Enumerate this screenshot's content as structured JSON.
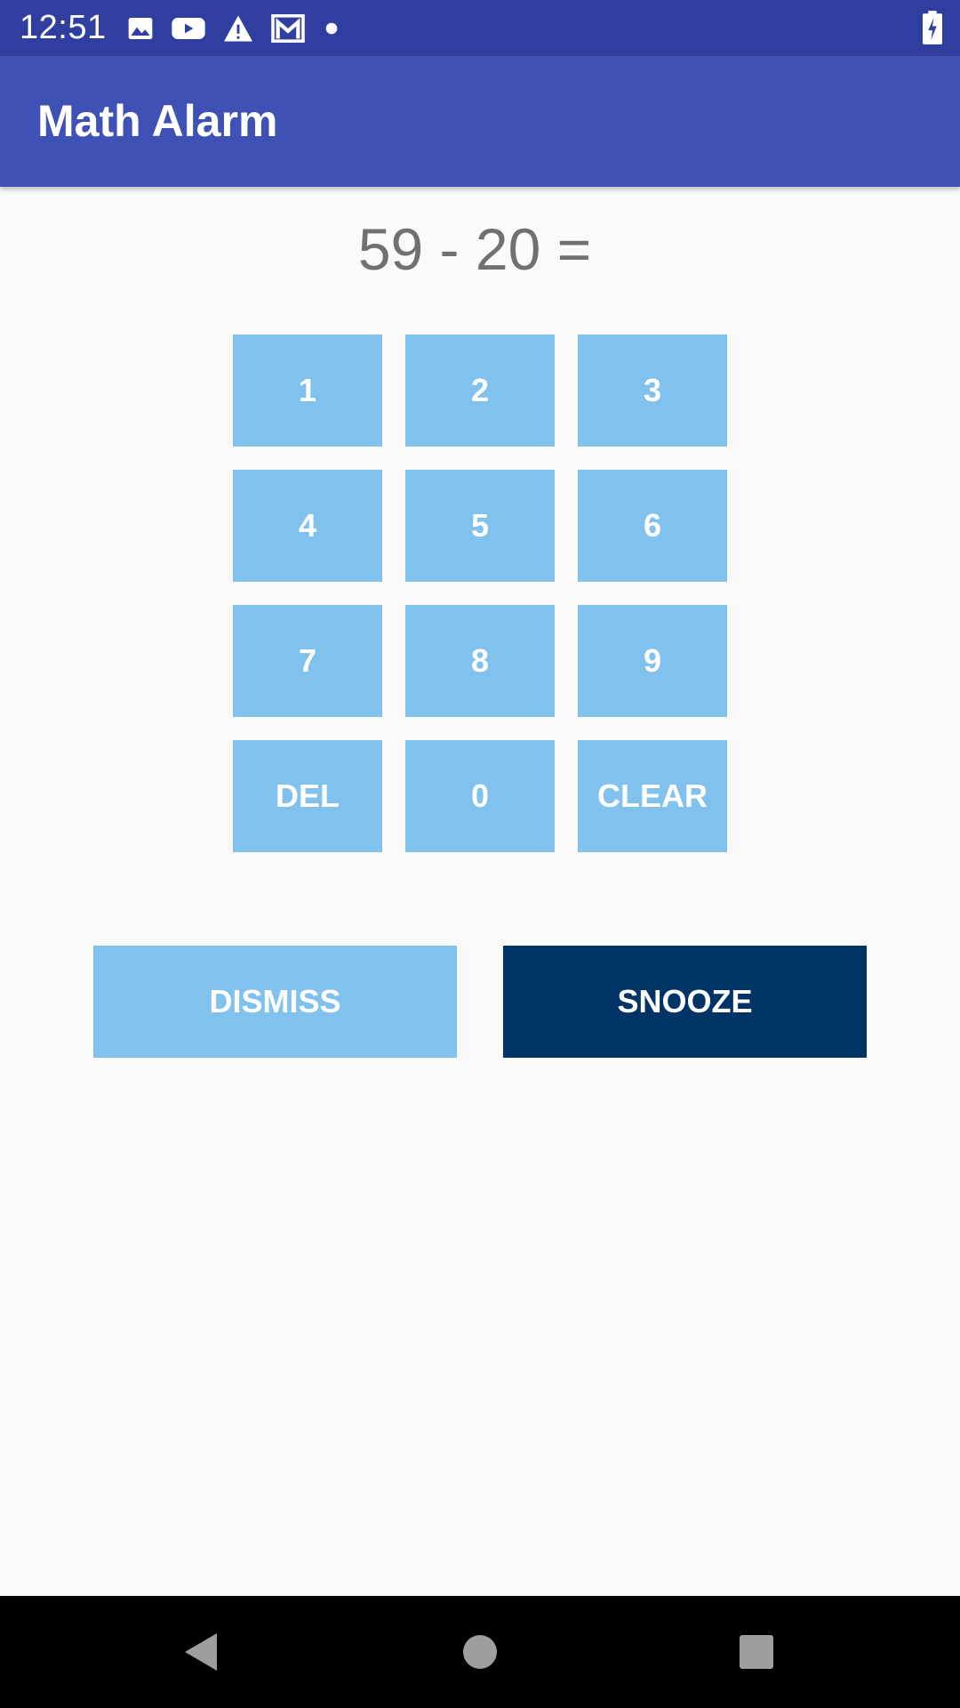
{
  "status_bar": {
    "time": "12:51",
    "icons": [
      "image-icon",
      "youtube-icon",
      "warning-icon",
      "gmail-icon",
      "dot-icon",
      "battery-charging-icon"
    ]
  },
  "app_bar": {
    "title": "Math Alarm"
  },
  "problem": {
    "text": "59 - 20 ="
  },
  "keypad": {
    "keys": [
      "1",
      "2",
      "3",
      "4",
      "5",
      "6",
      "7",
      "8",
      "9",
      "DEL",
      "0",
      "CLEAR"
    ]
  },
  "actions": {
    "dismiss_label": "DISMISS",
    "snooze_label": "SNOOZE"
  },
  "nav_bar": {
    "icons": [
      "back-icon",
      "home-icon",
      "recents-icon"
    ]
  },
  "colors": {
    "status_bar": "#303F9F",
    "app_bar": "#3F51B5",
    "key": "#81C1EE",
    "snooze": "#003366",
    "background": "#FAFAFA"
  }
}
